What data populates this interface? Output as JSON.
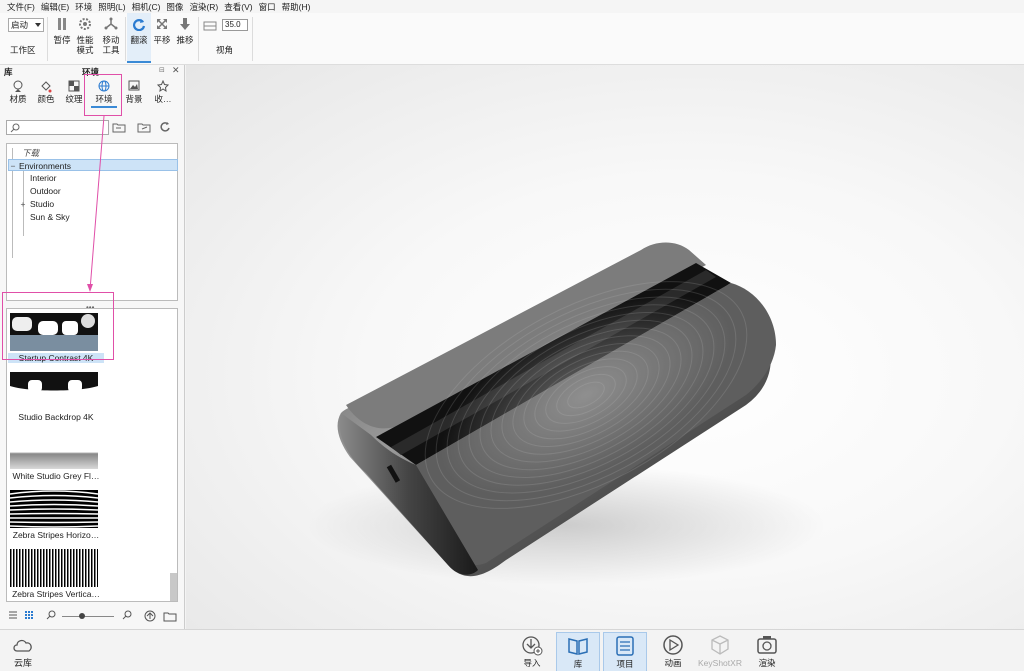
{
  "menu": [
    "文件(F)",
    "编辑(E)",
    "环境",
    "照明(L)",
    "相机(C)",
    "图像",
    "渲染(R)",
    "查看(V)",
    "窗口",
    "帮助(H)"
  ],
  "toolbar": {
    "workspace_value": "启动",
    "workspace_label": "工作区",
    "pause_label": "暂停",
    "perf_label_1": "性能",
    "perf_label_2": "模式",
    "move_label_1": "移动",
    "move_label_2": "工具",
    "tumble_label": "翻滚",
    "pan_label": "平移",
    "dolly_label": "推移",
    "fov_value": "35.0",
    "fov_label": "视角",
    "accent_color": "#3a8ad6"
  },
  "library": {
    "title": "库",
    "active_title": "环境",
    "tabs": [
      {
        "label": "材质",
        "icon": "material-ball-icon"
      },
      {
        "label": "颜色",
        "icon": "paint-bucket-icon"
      },
      {
        "label": "纹理",
        "icon": "texture-checker-icon"
      },
      {
        "label": "环境",
        "icon": "globe-icon"
      },
      {
        "label": "背景",
        "icon": "image-icon"
      },
      {
        "label": "收…",
        "icon": "star-icon"
      }
    ],
    "tree": {
      "downloads": "下载",
      "environments": "Environments",
      "interior": "Interior",
      "outdoor": "Outdoor",
      "studio": "Studio",
      "sun_sky": "Sun & Sky"
    },
    "splitter_dots": "•••",
    "thumbs": [
      {
        "label": "Startup Contrast 4K"
      },
      {
        "label": "Studio Backdrop 4K"
      },
      {
        "label": "White Studio Grey Fl…"
      },
      {
        "label": "Zebra Stripes Horizo…"
      },
      {
        "label": "Zebra Stripes Vertica…"
      }
    ],
    "highlight_color": "#e04fa8"
  },
  "bottom": {
    "cloud_label": "云库",
    "buttons": [
      {
        "label": "导入",
        "icon": "import-icon"
      },
      {
        "label": "库",
        "icon": "library-book-icon"
      },
      {
        "label": "项目",
        "icon": "project-list-icon"
      },
      {
        "label": "动画",
        "icon": "animation-play-icon"
      },
      {
        "label": "KeyShotXR",
        "icon": "keyshotxr-cube-icon"
      },
      {
        "label": "渲染",
        "icon": "render-camera-icon"
      }
    ]
  }
}
